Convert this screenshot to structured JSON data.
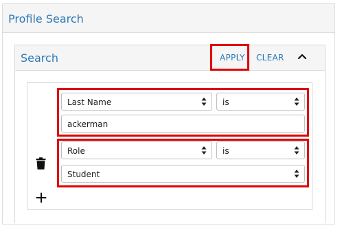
{
  "profile_panel": {
    "title": "Profile Search"
  },
  "search_card": {
    "title": "Search",
    "apply_label": "APPLY",
    "clear_label": "CLEAR",
    "collapse_icon": "chevron-up-icon"
  },
  "filters": [
    {
      "field": "Last Name",
      "operator": "is",
      "value": "ackerman",
      "value_type": "text"
    },
    {
      "field": "Role",
      "operator": "is",
      "value": "Student",
      "value_type": "select"
    }
  ],
  "icons": {
    "select_arrow": "sort-arrows-icon",
    "remove": "trash-icon",
    "add": "plus-icon"
  },
  "colors": {
    "link": "#2a78b8",
    "highlight": "#e00000",
    "header_bg": "#f5f5f5"
  }
}
